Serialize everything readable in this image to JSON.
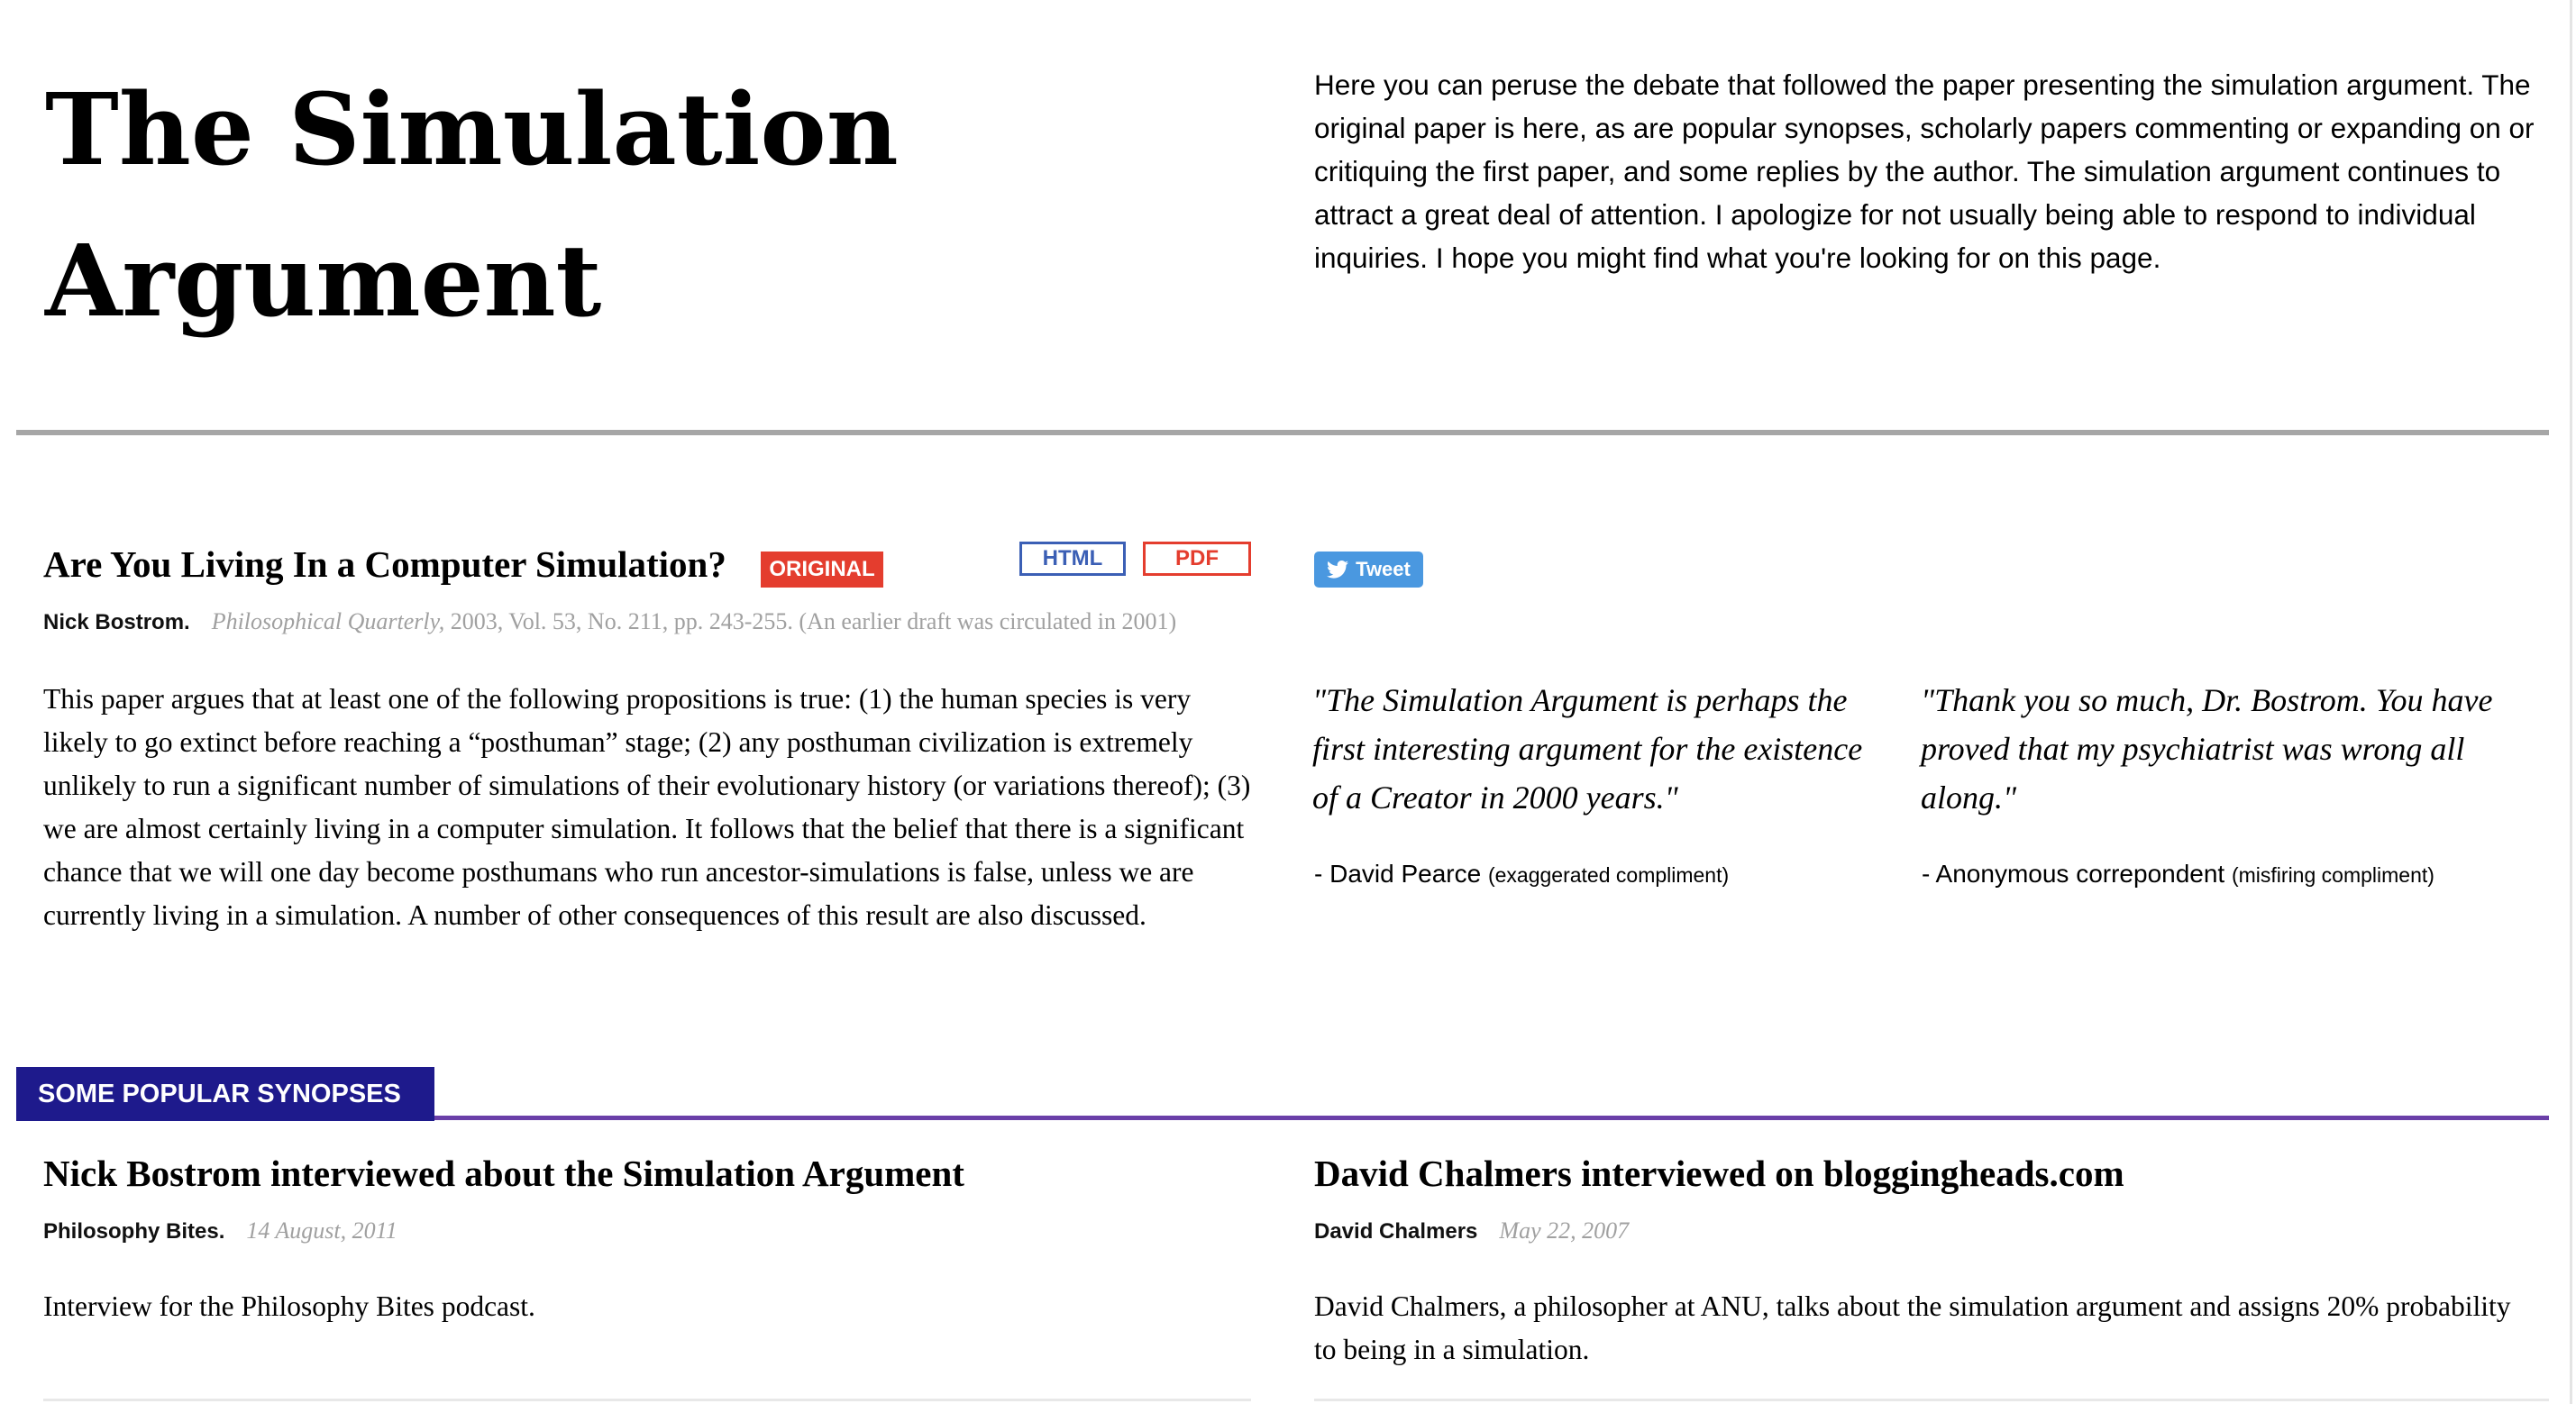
{
  "header": {
    "title_line1": "The Simulation",
    "title_line2": "Argument",
    "intro": "Here you can peruse the debate that followed the paper presenting the simulation argument. The original paper is here, as are popular synopses, scholarly papers commenting or expanding on or critiquing the first paper, and some replies by the author. The simulation argument continues to attract a great deal of attention. I apologize for not usually being able to respond to individual inquiries. I hope you might find what you're looking for on this page."
  },
  "original_paper": {
    "title": "Are You Living In a Computer Simulation?",
    "badge": "ORIGINAL",
    "html_label": "HTML",
    "pdf_label": "PDF",
    "author": "Nick Bostrom.",
    "journal": "Philosophical Quarterly,",
    "citation": " 2003, Vol. 53, No. 211, pp. 243-255. (An earlier draft was circulated in 2001)",
    "abstract": "This paper argues that at least one of the following propositions is true: (1) the human species is very likely to go extinct before reaching a “posthuman” stage; (2) any posthuman civilization is extremely unlikely to run a significant number of simulations of their evolutionary history (or variations thereof); (3) we are almost certainly living in a computer simulation. It follows that the belief that there is a significant chance that we will one day become posthumans who run ancestor-simulations is false, unless we are currently living in a simulation. A number of other consequences of this result are also discussed."
  },
  "tweet": {
    "label": "Tweet",
    "icon": "twitter-bird-icon",
    "color": "#4a98e0"
  },
  "quotes": [
    {
      "text": "\"The Simulation Argument is perhaps the first interesting argument for the existence of a Creator in 2000 years.\"",
      "attribution": "- David Pearce ",
      "note": "(exaggerated compliment)"
    },
    {
      "text": "\"Thank you so much, Dr. Bostrom. You have proved that my psychiatrist was wrong all along.\"",
      "attribution": "- Anonymous correpondent ",
      "note": "(misfiring compliment)"
    }
  ],
  "synopses": {
    "section_label": "SOME POPULAR SYNOPSES",
    "items": [
      {
        "title": "Nick Bostrom interviewed about the Simulation Argument",
        "source": "Philosophy Bites.",
        "date": "14 August, 2011",
        "description": "Interview for the Philosophy Bites podcast."
      },
      {
        "title": "David Chalmers interviewed on bloggingheads.com",
        "source": "David Chalmers",
        "date": "May 22, 2007",
        "description": "David Chalmers, a philosopher at ANU, talks about the simulation argument and assigns 20% probability to being in a simulation."
      }
    ]
  },
  "colors": {
    "original_badge": "#e43d2e",
    "html_button": "#3b5fb5",
    "pdf_button": "#e43d2e",
    "section_tag": "#1e1a8c",
    "section_rule": "#6a3fa8",
    "main_rule": "#a6a6a6"
  }
}
